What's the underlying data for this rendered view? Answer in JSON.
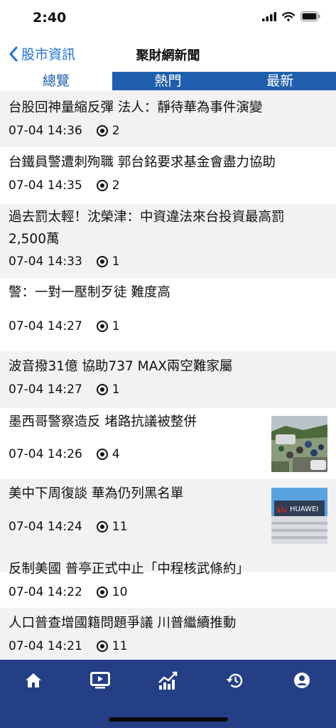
{
  "status_bar": {
    "time": "2:40"
  },
  "nav": {
    "back_label": "股市資訊",
    "title": "聚財網新聞"
  },
  "tabs": [
    {
      "label": "總覽",
      "active": true
    },
    {
      "label": "熱門",
      "active": false
    },
    {
      "label": "最新",
      "active": false
    }
  ],
  "news": [
    {
      "title": "台股回神量縮反彈 法人：靜待華為事件演變",
      "time": "07-04 14:36",
      "views": "2"
    },
    {
      "title": "台鐵員警遭刺殉職 郭台銘要求基金會盡力協助",
      "time": "07-04 14:35",
      "views": "2"
    },
    {
      "title_line1": "過去罰太輕！沈榮津：中資違法來台投資最高罰",
      "title_line2": "2,500萬",
      "time": "07-04 14:33",
      "views": "1"
    },
    {
      "title": "警：一對一壓制歹徒 難度高",
      "time": "07-04 14:27",
      "views": "1"
    },
    {
      "title": "波音撥31億 協助737 MAX兩空難家屬",
      "time": "07-04 14:27",
      "views": "1"
    },
    {
      "title": "墨西哥警察造反 堵路抗議被整併",
      "time": "07-04 14:26",
      "views": "4"
    },
    {
      "title": "美中下周復談 華為仍列黑名單",
      "time": "07-04 14:24",
      "views": "11"
    },
    {
      "title": "反制美國 普亭正式中止「中程核武條約」",
      "time": "07-04 14:22",
      "views": "10"
    },
    {
      "title": "人口普查增國籍問題爭議 川普繼續推動",
      "time": "07-04 14:21",
      "views": "11"
    }
  ],
  "thumb_text": {
    "huawei": "HUAWEI"
  },
  "tabbar": [
    {
      "icon": "home-icon"
    },
    {
      "icon": "video-icon"
    },
    {
      "icon": "chart-icon"
    },
    {
      "icon": "history-icon"
    },
    {
      "icon": "account-icon"
    }
  ],
  "colors": {
    "accent": "#1e73d8",
    "tab_bg": "#1f5fae",
    "tabbar_bg": "#253f86",
    "row_alt": "#f2f2f2"
  }
}
